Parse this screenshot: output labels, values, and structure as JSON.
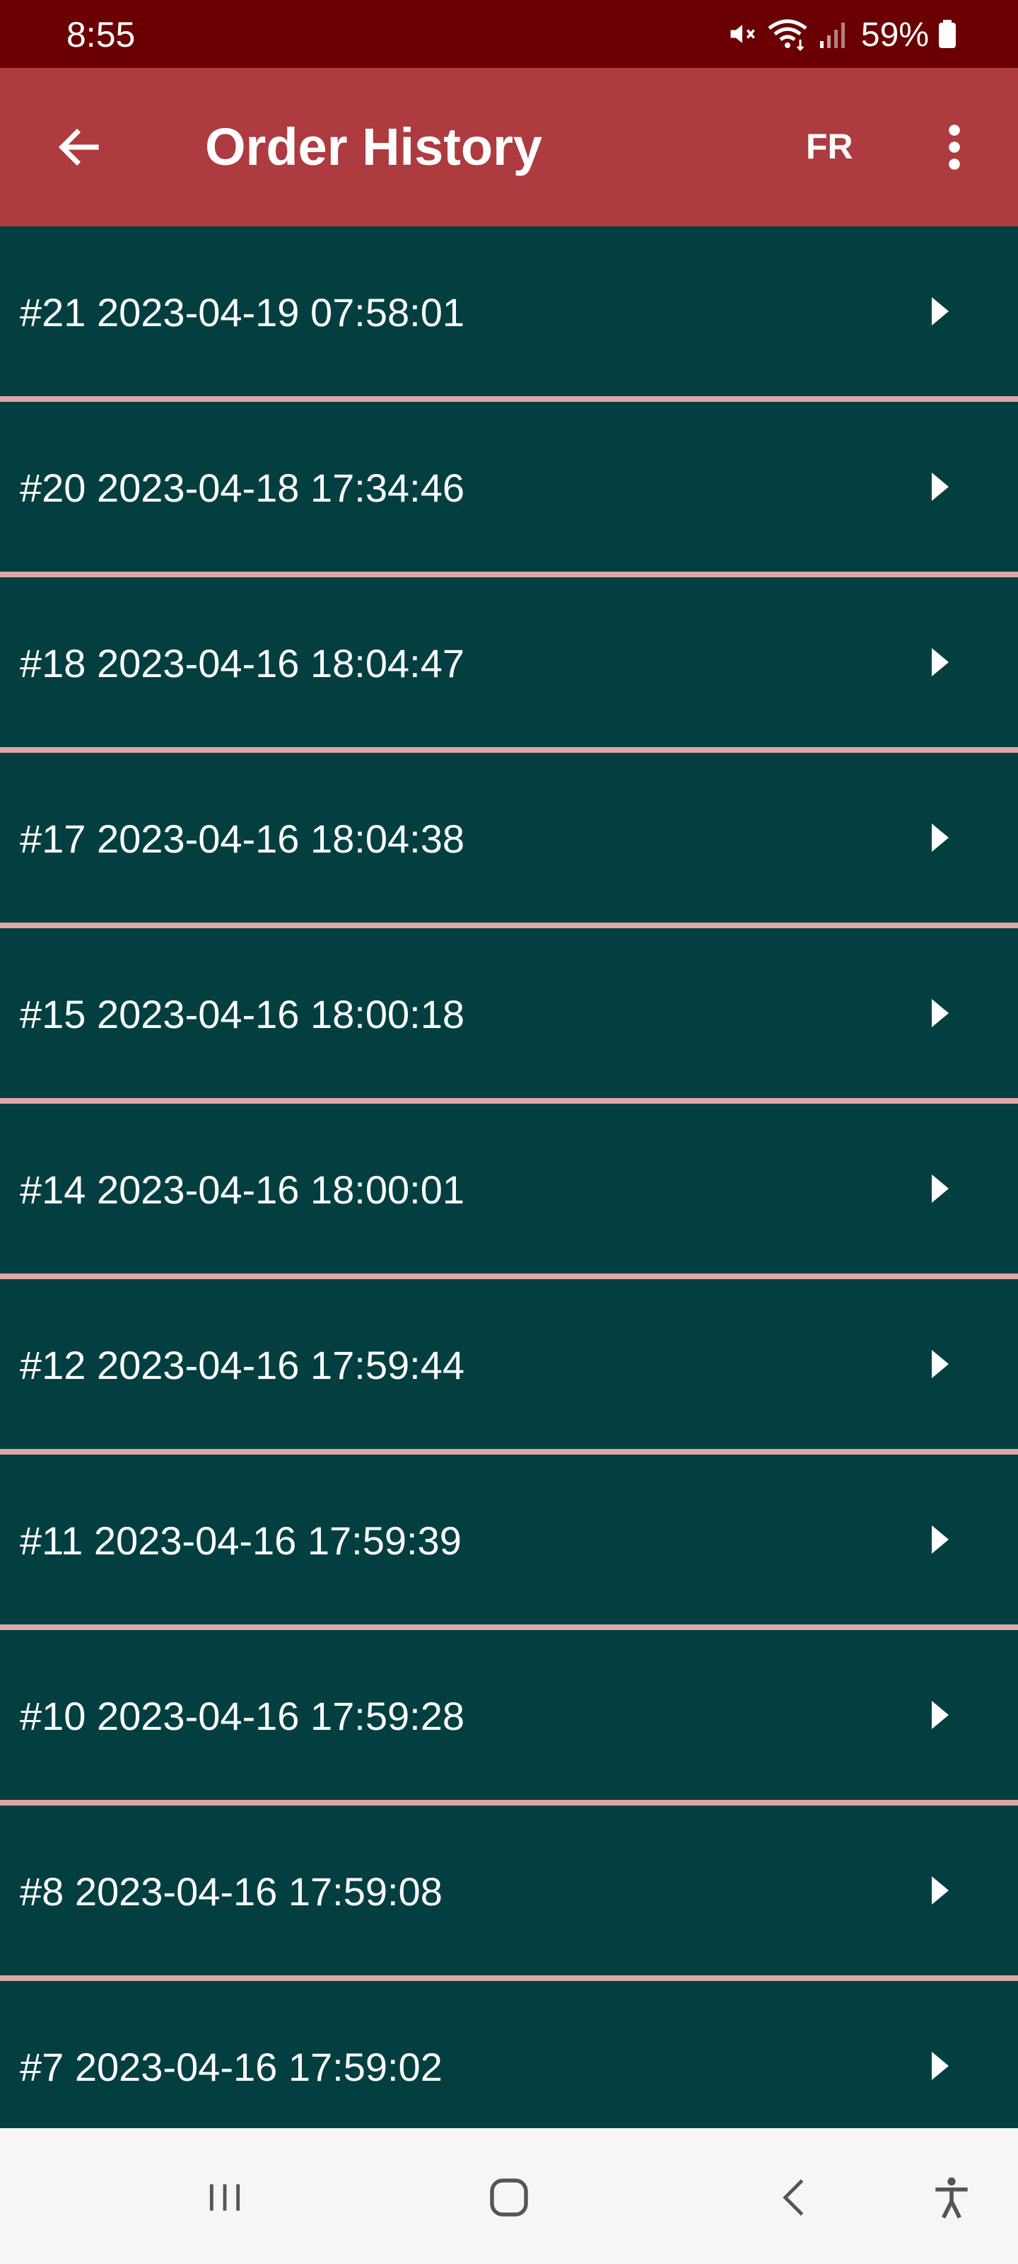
{
  "status_bar": {
    "time": "8:55",
    "battery": "59%",
    "icons": [
      "mute-icon",
      "wifi-icon",
      "signal-icon",
      "battery-icon"
    ]
  },
  "app_bar": {
    "title": "Order History",
    "language": "FR",
    "back_icon": "arrow-left-icon",
    "menu_icon": "more-vertical-icon"
  },
  "orders": [
    {
      "label": "#21 2023-04-19 07:58:01"
    },
    {
      "label": "#20 2023-04-18 17:34:46"
    },
    {
      "label": "#18 2023-04-16 18:04:47"
    },
    {
      "label": "#17 2023-04-16 18:04:38"
    },
    {
      "label": "#15 2023-04-16 18:00:18"
    },
    {
      "label": "#14 2023-04-16 18:00:01"
    },
    {
      "label": "#12 2023-04-16 17:59:44"
    },
    {
      "label": "#11 2023-04-16 17:59:39"
    },
    {
      "label": "#10 2023-04-16 17:59:28"
    },
    {
      "label": "#8 2023-04-16 17:59:08"
    },
    {
      "label": "#7 2023-04-16 17:59:02"
    }
  ],
  "nav_bar": {
    "icons": [
      "recent-apps-icon",
      "home-icon",
      "back-icon",
      "accessibility-icon"
    ]
  },
  "colors": {
    "status_bar": "#6a0003",
    "app_bar": "#ad3b3f",
    "row_background": "#033f41",
    "row_divider": "#dfa6a6",
    "nav_background": "#f6f6f6"
  }
}
